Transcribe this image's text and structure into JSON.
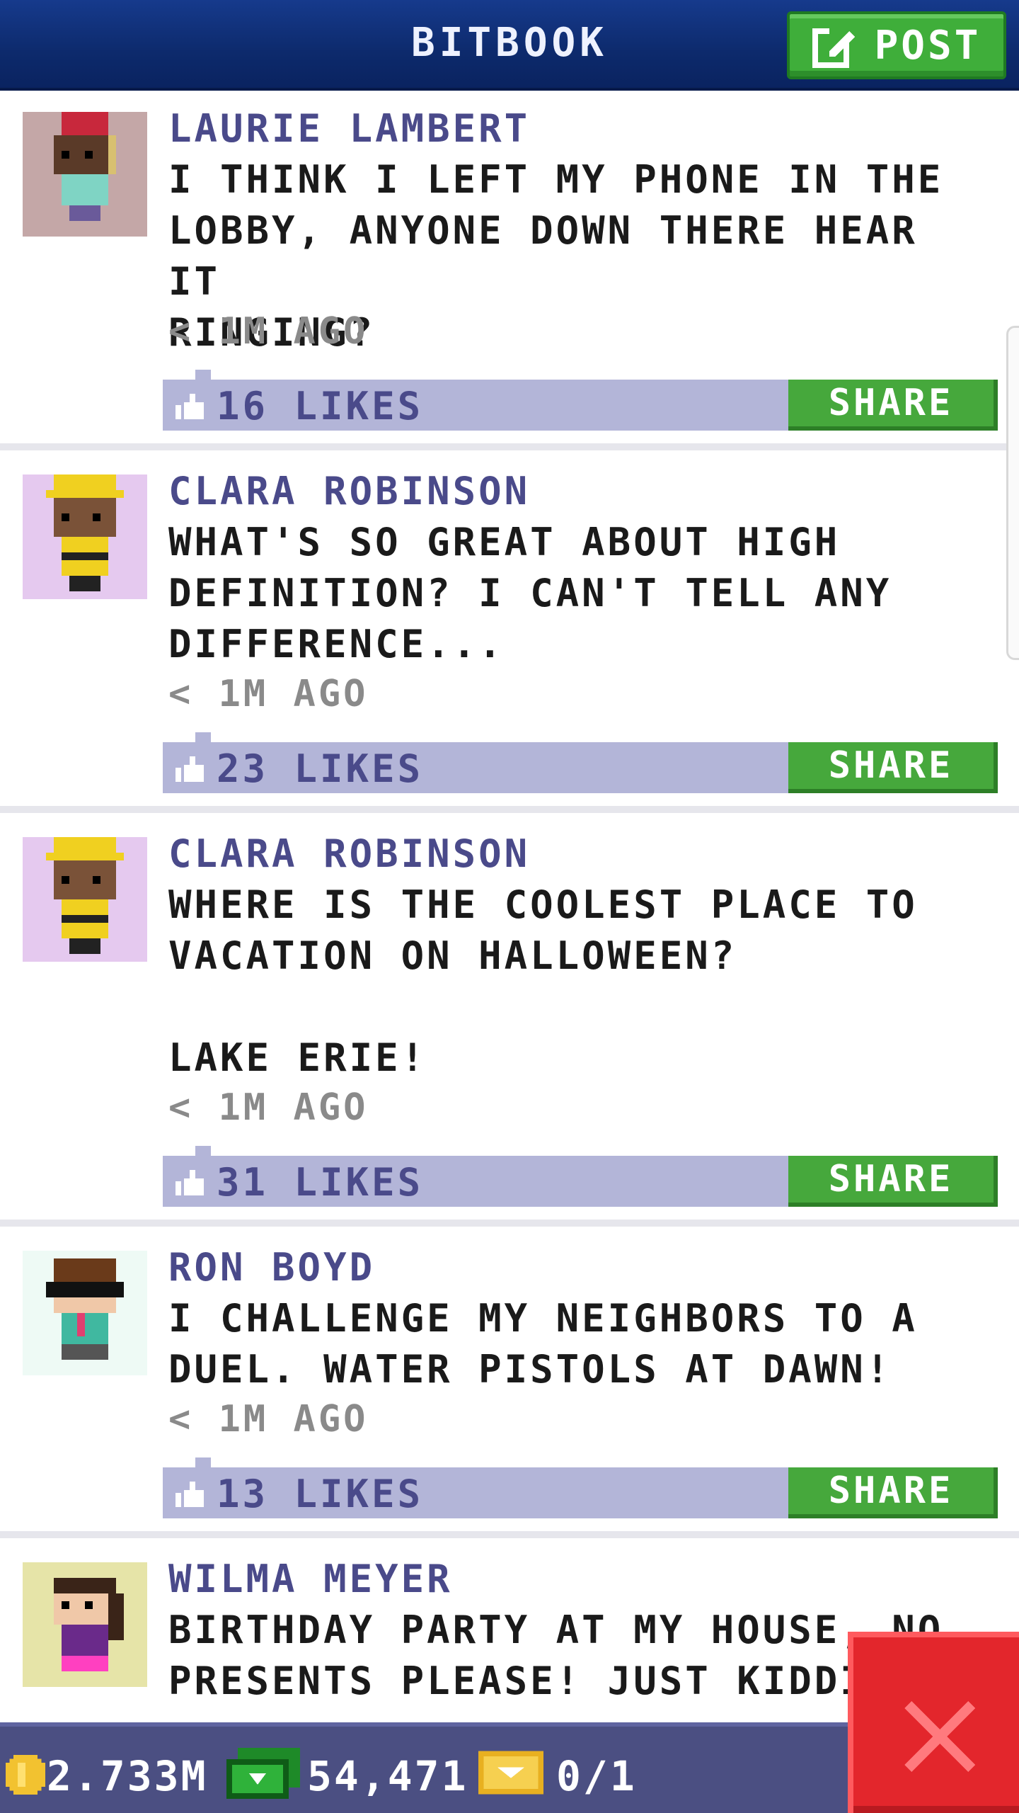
{
  "header": {
    "title": "BITBOOK",
    "post_label": "POST"
  },
  "posts": [
    {
      "author": "LAURIE LAMBERT",
      "message": "I THINK I LEFT MY PHONE IN THE\nLOBBY, ANYONE DOWN THERE HEAR IT\nRINGING?",
      "time": "< 1M AGO",
      "likes": "16 LIKES",
      "share_label": "SHARE",
      "avatar_bg": "#c4a7a7"
    },
    {
      "author": "CLARA ROBINSON",
      "message": "WHAT'S SO GREAT ABOUT HIGH\nDEFINITION? I CAN'T TELL ANY\nDIFFERENCE...",
      "time": "< 1M AGO",
      "likes": "23 LIKES",
      "share_label": "SHARE",
      "avatar_bg": "#e5c9ef"
    },
    {
      "author": "CLARA ROBINSON",
      "message": "WHERE IS THE COOLEST PLACE TO\nVACATION ON HALLOWEEN?\n\nLAKE ERIE!",
      "time": "< 1M AGO",
      "likes": "31 LIKES",
      "share_label": "SHARE",
      "avatar_bg": "#e5c9ef"
    },
    {
      "author": "RON BOYD",
      "message": "I CHALLENGE MY NEIGHBORS TO A\nDUEL. WATER PISTOLS AT DAWN!",
      "time": "< 1M AGO",
      "likes": "13 LIKES",
      "share_label": "SHARE",
      "avatar_bg": "#eefaf5"
    },
    {
      "author": "WILMA MEYER",
      "message": "BIRTHDAY PARTY AT MY HOUSE, NO\nPRESENTS PLEASE! JUST KIDDING",
      "time": "",
      "likes": "",
      "share_label": "",
      "avatar_bg": "#e6e4a8"
    }
  ],
  "footer": {
    "coins": "2.733M",
    "bux": "54,471",
    "tickets": "0/1"
  },
  "colors": {
    "header_blue": "#0d2a6c",
    "post_green": "#3fae3a",
    "likes_bar": "#b3b5d8",
    "author_purple": "#4a4a8a",
    "footer_bg": "#4b4f82",
    "close_red": "#e3262c"
  },
  "icons": {
    "post": "edit-icon",
    "like": "thumbs-up-icon",
    "coin": "coin-icon",
    "bux": "bux-icon",
    "ticket": "golden-ticket-icon",
    "close": "close-icon"
  }
}
